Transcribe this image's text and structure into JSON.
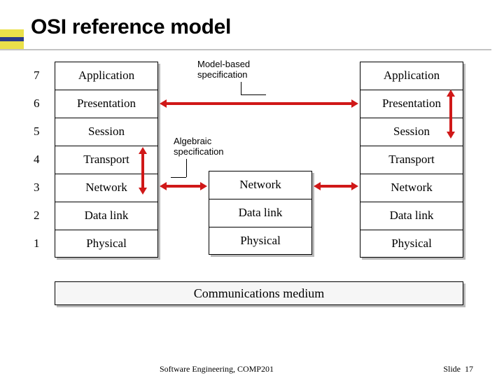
{
  "title": "OSI reference model",
  "numbers": [
    "7",
    "6",
    "5",
    "4",
    "3",
    "2",
    "1"
  ],
  "stackA": [
    "Application",
    "Presentation",
    "Session",
    "Transport",
    "Network",
    "Data link",
    "Physical"
  ],
  "stackB": [
    "Network",
    "Data link",
    "Physical"
  ],
  "stackC": [
    "Application",
    "Presentation",
    "Session",
    "Transport",
    "Network",
    "Data link",
    "Physical"
  ],
  "medium": "Communications medium",
  "labels": {
    "model": "Model-based\nspecification",
    "algebraic": "Algebraic\nspecification"
  },
  "footer": {
    "course": "Software Engineering, COMP201",
    "slide_label": "Slide",
    "slide_num": "17"
  }
}
